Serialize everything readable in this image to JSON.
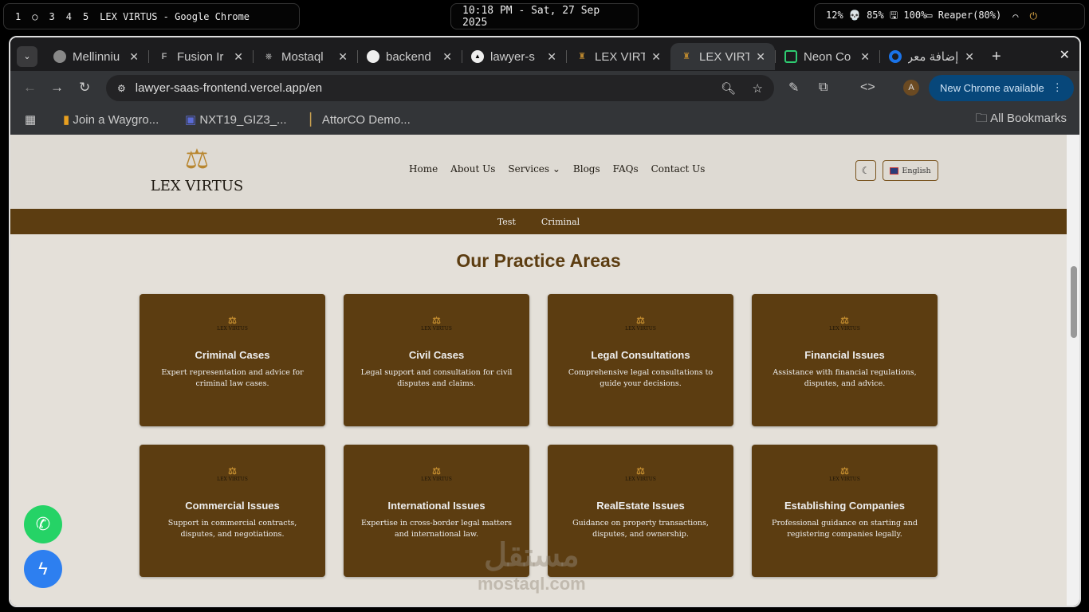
{
  "system_bar": {
    "workspaces": [
      "1",
      "○",
      "3",
      "4",
      "5"
    ],
    "window_title": "LEX VIRTUS - Google Chrome",
    "clock": "10:18 PM - Sat, 27 Sep 2025",
    "status": "12% 💀 85% 🖫 100%▭ Reaper(80%)"
  },
  "tabs": [
    {
      "title": "Mellinniu",
      "icon": "globe-icon"
    },
    {
      "title": "Fusion Ir",
      "icon": "fusion-icon"
    },
    {
      "title": "Mostaql",
      "icon": "openai-icon"
    },
    {
      "title": "backend",
      "icon": "db-icon"
    },
    {
      "title": "lawyer-s",
      "icon": "vercel-icon"
    },
    {
      "title": "LEX VIRT",
      "icon": "lex-icon"
    },
    {
      "title": "LEX VIRT",
      "icon": "lex-icon",
      "active": true
    },
    {
      "title": "Neon Co",
      "icon": "neon-icon"
    },
    {
      "title": "إضافة معر",
      "icon": "circle-icon"
    }
  ],
  "address": "lawyer-saas-frontend.vercel.app/en",
  "profile_initial": "A",
  "update_label": "New Chrome available",
  "bookmarks": [
    "Join a Waygro...",
    "NXT19_GIZ3_...",
    "AttorCO Demo..."
  ],
  "all_bookmarks": "All Bookmarks",
  "site": {
    "logo": "LEX VIRTUS",
    "nav": [
      "Home",
      "About Us",
      "Services",
      "Blogs",
      "FAQs",
      "Contact Us"
    ],
    "language": "English",
    "subnav": [
      "Test",
      "Criminal"
    ],
    "section_title": "Our Practice Areas",
    "cards": [
      {
        "title": "Criminal Cases",
        "desc": "Expert representation and advice for criminal law cases."
      },
      {
        "title": "Civil Cases",
        "desc": "Legal support and consultation for civil disputes and claims."
      },
      {
        "title": "Legal Consultations",
        "desc": "Comprehensive legal consultations to guide your decisions."
      },
      {
        "title": "Financial Issues",
        "desc": "Assistance with financial regulations, disputes, and advice."
      },
      {
        "title": "Commercial Issues",
        "desc": "Support in commercial contracts, disputes, and negotiations."
      },
      {
        "title": "International Issues",
        "desc": "Expertise in cross-border legal matters and international law."
      },
      {
        "title": "RealEstate Issues",
        "desc": "Guidance on property transactions, disputes, and ownership."
      },
      {
        "title": "Establishing Companies",
        "desc": "Professional guidance on starting and registering companies legally."
      }
    ]
  },
  "watermark": {
    "ar": "مستقل",
    "en": "mostaql.com"
  }
}
